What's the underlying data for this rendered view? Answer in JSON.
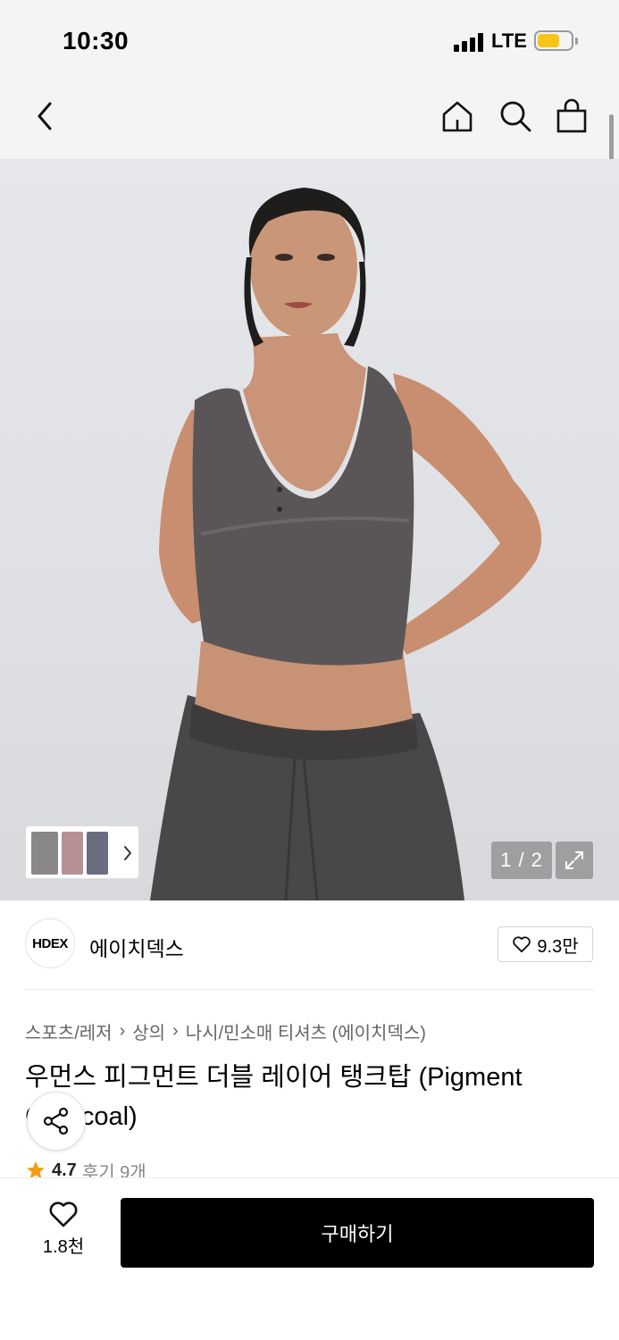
{
  "status_bar": {
    "time": "10:30",
    "network": "LTE",
    "battery_level": 0.6
  },
  "header": {
    "back_icon": "chevron-left-icon",
    "home_icon": "home-icon",
    "search_icon": "search-icon",
    "bag_icon": "shopping-bag-icon"
  },
  "gallery": {
    "current": "1",
    "total": "2",
    "counter": "1 / 2",
    "expand_icon": "expand-icon",
    "thumb_next_icon": "chevron-right-icon"
  },
  "brand": {
    "logo_text": "HDEX",
    "name": "에이치덱스",
    "likes": "9.3만"
  },
  "breadcrumb": [
    "스포츠/레저",
    "상의",
    "나시/민소매 티셔츠 (에이치덱스)"
  ],
  "product": {
    "title": "우먼스 피그먼트 더블 레이어 탱크탑 (Pigment Charcoal)",
    "rating": "4.7",
    "reviews": "후기 9개"
  },
  "bottom_bar": {
    "wish_count": "1.8천",
    "buy_label": "구매하기"
  },
  "colors": {
    "buy_button": "#000000",
    "star": "#f39c12",
    "battery": "#f5c518"
  }
}
